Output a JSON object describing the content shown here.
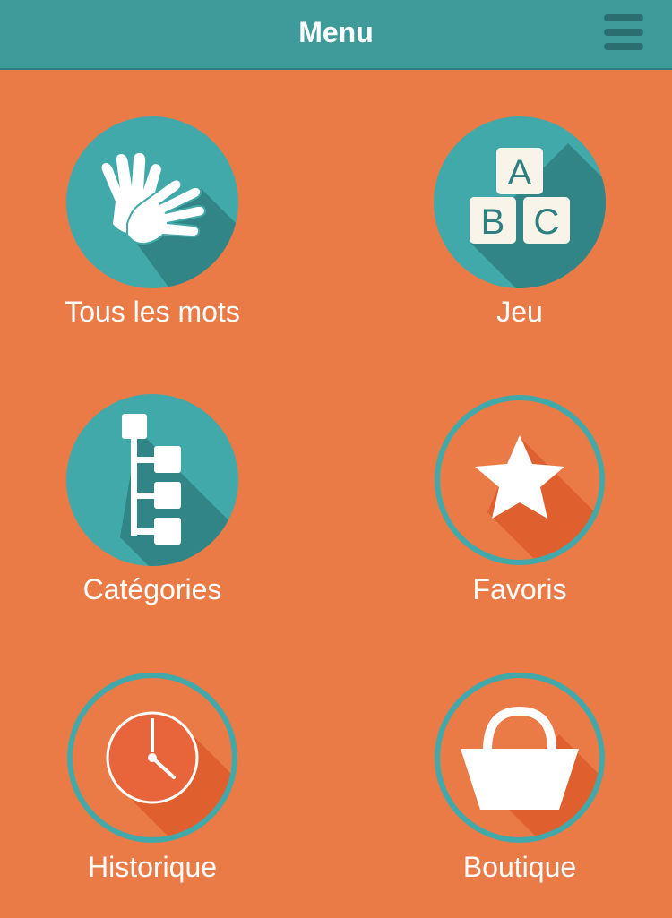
{
  "header": {
    "title": "Menu",
    "menu_icon": "hamburger-icon"
  },
  "menu": {
    "items": [
      {
        "label": "Tous les mots",
        "icon": "sign-language-hands-icon"
      },
      {
        "label": "Jeu",
        "icon": "abc-blocks-icon"
      },
      {
        "label": "Catégories",
        "icon": "tree-hierarchy-icon"
      },
      {
        "label": "Favoris",
        "icon": "star-icon"
      },
      {
        "label": "Historique",
        "icon": "clock-icon"
      },
      {
        "label": "Boutique",
        "icon": "shopping-basket-icon"
      }
    ]
  },
  "blocks": {
    "a": "A",
    "b": "B",
    "c": "C"
  },
  "colors": {
    "background": "#ea7b46",
    "header": "#3f9a9a",
    "teal": "#42a9aa",
    "teal_shadow": "#2e7f80",
    "orange_shadow": "#df5f2e",
    "white": "#ffffff"
  }
}
